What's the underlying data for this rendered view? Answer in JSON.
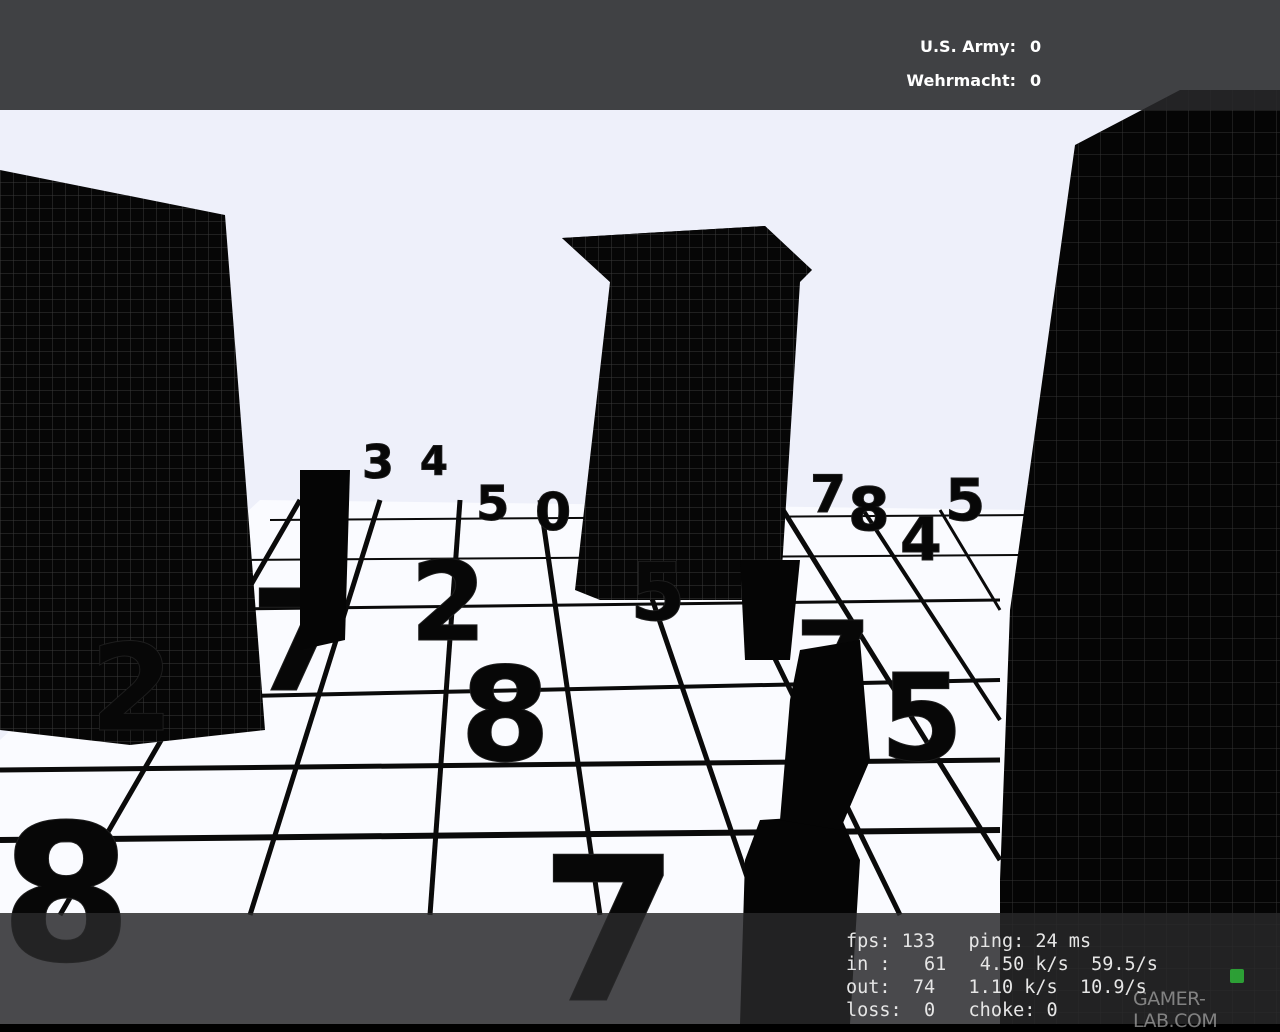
{
  "scoreboard": {
    "teams": [
      {
        "name": "U.S. Army:",
        "score": "0"
      },
      {
        "name": "Wehrmacht:",
        "score": "0"
      }
    ]
  },
  "netgraph": {
    "fps_label": "fps:",
    "fps": "133",
    "ping_label": "ping:",
    "ping": "24 ms",
    "in_label": "in :",
    "in_packets": "61",
    "in_rate": "4.50 k/s",
    "in_pps": "59.5/s",
    "out_label": "out:",
    "out_packets": "74",
    "out_rate": "1.10 k/s",
    "out_pps": "10.9/s",
    "loss_label": "loss:",
    "loss": "0",
    "choke_label": "choke:",
    "choke": "0"
  },
  "watermark": "GAMER-LAB.COM",
  "scene_digits": [
    "3",
    "4",
    "5",
    "0",
    "7",
    "8",
    "4",
    "5",
    "7",
    "2",
    "8",
    "5",
    "7",
    "1"
  ],
  "colors": {
    "sky": "#eef0fa",
    "floor": "#ffffff",
    "block": "#080808",
    "hud_bg": "#28282a"
  }
}
